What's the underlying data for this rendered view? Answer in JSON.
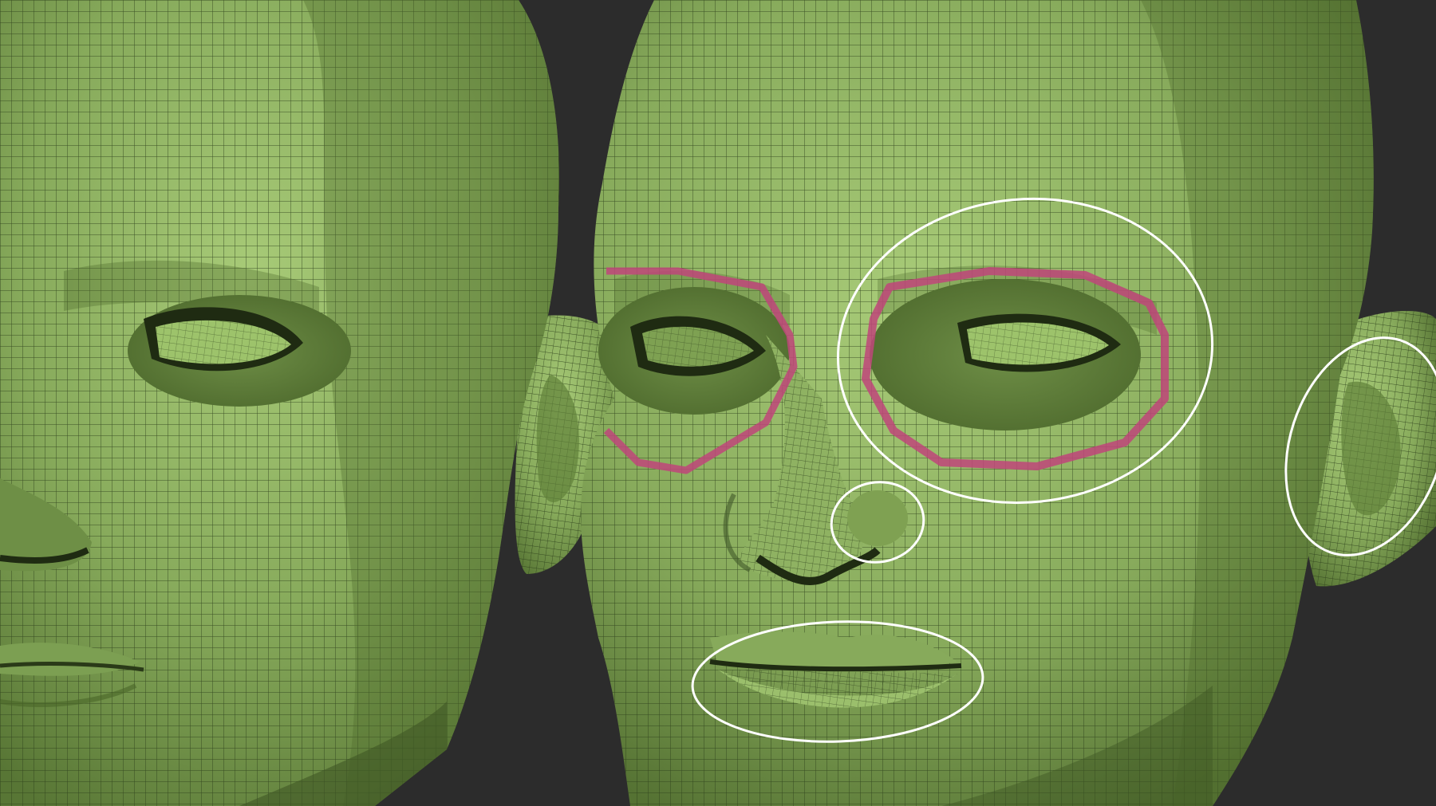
{
  "scene": {
    "background_color": "#2c2c2c",
    "mesh_base_color": "#86a95a",
    "mesh_light_color": "#a3c774",
    "mesh_shadow_color": "#5b7a37",
    "wire_color": "#2d3f1b",
    "highlight_loop_color": "#c0457a",
    "guide_outline_color": "#ffffff"
  },
  "heads": [
    {
      "name": "left-head",
      "view": "three-quarter",
      "has_annotations": false
    },
    {
      "name": "right-head",
      "view": "three-quarter",
      "has_annotations": true
    }
  ],
  "annotations": {
    "highlighted_edge_loops": [
      "right-eye-loop",
      "left-eye-loop"
    ],
    "outlined_regions": [
      "eye-region",
      "ear",
      "nostril",
      "mouth"
    ]
  }
}
